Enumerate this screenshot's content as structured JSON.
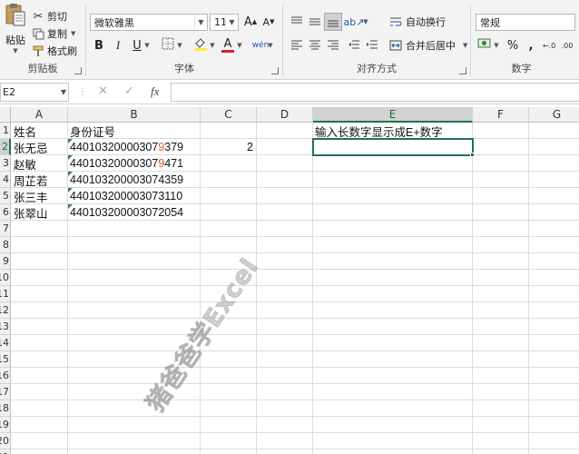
{
  "ribbon": {
    "clipboard": {
      "paste_label": "粘贴",
      "cut_label": "剪切",
      "copy_label": "复制",
      "format_painter_label": "格式刷",
      "group_label": "剪贴板"
    },
    "font": {
      "font_name": "微软雅黑",
      "font_size": "11",
      "bold": "B",
      "italic": "I",
      "underline": "U",
      "group_label": "字体"
    },
    "alignment": {
      "wrap_text_label": "自动换行",
      "merge_center_label": "合并后居中",
      "group_label": "对齐方式"
    },
    "number": {
      "format_value": "常规",
      "percent_symbol": "%",
      "comma_symbol": ",",
      "group_label": "数字"
    }
  },
  "formula_bar": {
    "name_box": "E2",
    "fx_label": "fx",
    "cancel_symbol": "✕",
    "enter_symbol": "✓",
    "formula": ""
  },
  "sheet": {
    "columns": [
      "A",
      "B",
      "C",
      "D",
      "E",
      "F",
      "G"
    ],
    "rows": [
      "1",
      "2",
      "3",
      "4",
      "5",
      "6",
      "7",
      "8",
      "9",
      "10",
      "11",
      "12",
      "13",
      "14",
      "15",
      "16",
      "17",
      "18",
      "19",
      "20",
      "21"
    ],
    "selected_cell": "E2",
    "cells": {
      "A1": "姓名",
      "B1": "身份证号",
      "A2": "张无忌",
      "A3": "赵敏",
      "A4": "周芷若",
      "A5": "张三丰",
      "A6": "张翠山",
      "B2_prefix": "44010320000307",
      "B2_hl": "9",
      "B2_suffix": "379",
      "B3_prefix": "44010320000307",
      "B3_hl": "9",
      "B3_suffix": "471",
      "B4": "440103200003074359",
      "B5": "440103200003073110",
      "B6": "440103200003072054",
      "C2": "2",
      "E1": "输入长数字显示成E+数字"
    },
    "watermark": "猪爸爸学Excel"
  },
  "colors": {
    "accent": "#217346",
    "highlight_digit": "#e0601e",
    "font_red": "#e02020",
    "fill_yellow": "#ffeb3b"
  }
}
